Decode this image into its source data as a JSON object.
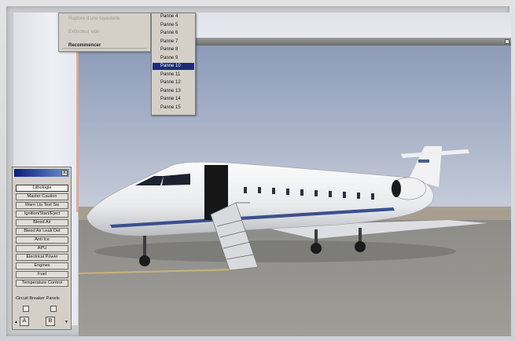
{
  "menu_primary": {
    "items": [
      {
        "label": "Rupture d'une tuyauterie",
        "enabled": false
      },
      {
        "label": "Extincteur vide",
        "enabled": false
      },
      {
        "label": "Recommencer",
        "enabled": true
      }
    ]
  },
  "panne_menu": {
    "items": [
      "Panne 4",
      "Panne 5",
      "Panne 6",
      "Panne 7",
      "Panne 8",
      "Panne 9",
      "Panne 10",
      "Panne 11",
      "Panne 12",
      "Panne 13",
      "Panne 14",
      "Panne 15"
    ],
    "selected": "Panne 10",
    "selected_color": "#1c2b7a"
  },
  "systems_panel": {
    "close_glyph": "x",
    "buttons": [
      "Lithologie",
      "Master Caution",
      "Warn Lts Test Sw",
      "Ignition/Start/Eject",
      "Bleed Air",
      "Bleed Air Leak Det",
      "Anti Ice",
      "APU",
      "Electrical Power",
      "Engines",
      "Fuel",
      "Temperature Control"
    ],
    "active_button": "Lithologie",
    "circuit_label": "Circuit Breaker Panels",
    "step_left_label": "A",
    "step_right_label": "B",
    "step_up": "▲",
    "step_down": "▼"
  },
  "colors": {
    "menu_bg": "#d4d0c8",
    "panel_title_start": "#0a1f7a",
    "panel_title_end": "#6f8fd0"
  }
}
